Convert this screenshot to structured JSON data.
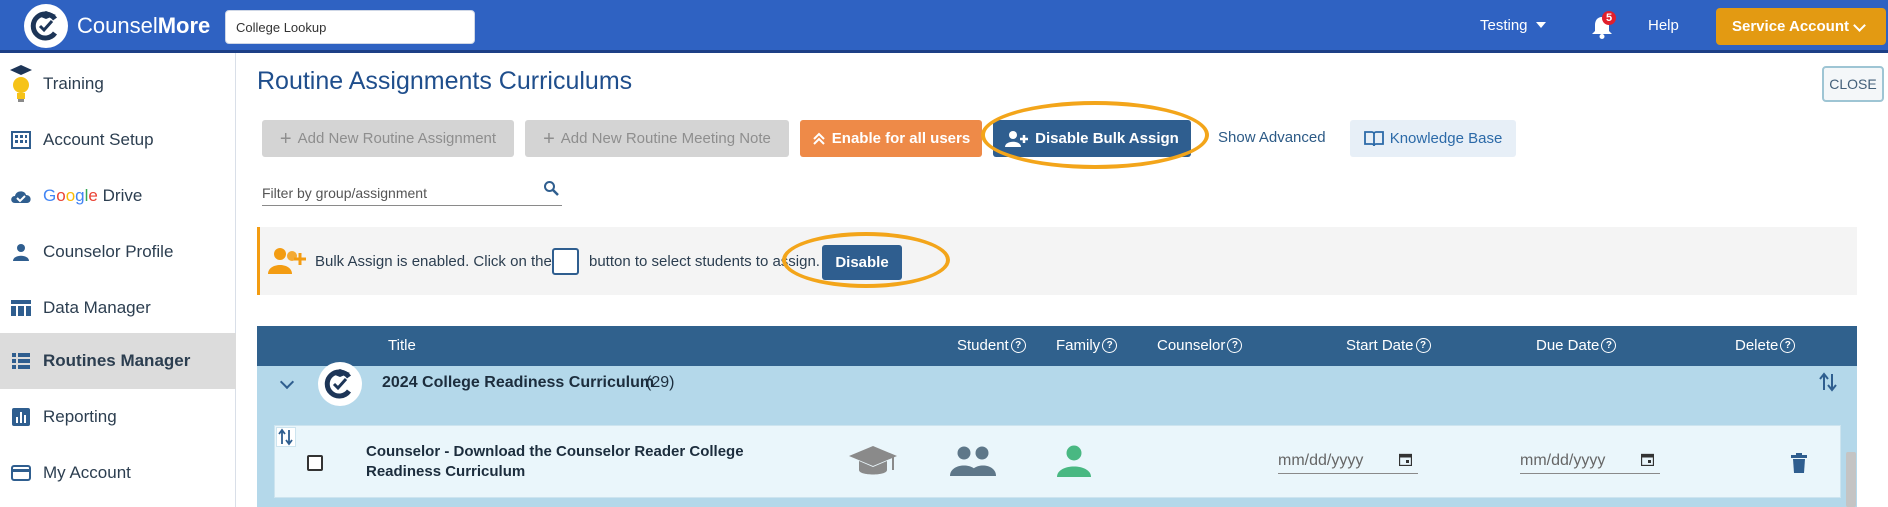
{
  "header": {
    "brand_light": "Counsel",
    "brand_bold": "More",
    "lookup_value": "College Lookup",
    "user_menu": "Testing",
    "notification_count": "5",
    "help": "Help",
    "service_account": "Service Account",
    "bar_color": "#2f62c2",
    "service_color": "#e39a12"
  },
  "sidebar": {
    "items": [
      {
        "label": "Training",
        "icon": "graduation-bulb-icon"
      },
      {
        "label": "Account Setup",
        "icon": "building-icon"
      },
      {
        "label_g": "Google",
        "label": "Drive",
        "icon": "cloud-check-icon"
      },
      {
        "label": "Counselor Profile",
        "icon": "person-icon"
      },
      {
        "label": "Data Manager",
        "icon": "table-icon"
      },
      {
        "label": "Routines Manager",
        "icon": "list-icon",
        "active": true
      },
      {
        "label": "Reporting",
        "icon": "bar-chart-icon"
      },
      {
        "label": "My Account",
        "icon": "card-icon"
      }
    ]
  },
  "main": {
    "title": "Routine Assignments Curriculums",
    "close": "CLOSE",
    "toolbar": {
      "add_assignment": "Add New Routine Assignment",
      "add_note": "Add New Routine Meeting Note",
      "enable_all": "Enable for all users",
      "disable_bulk": "Disable Bulk Assign",
      "show_advanced": "Show Advanced",
      "knowledge_base": "Knowledge Base"
    },
    "filter_placeholder": "Filter by group/assignment",
    "banner": {
      "text_before": "Bulk Assign is enabled. Click on the",
      "text_after": "button to select students to assign.",
      "disable": "Disable"
    },
    "table": {
      "columns": [
        "Title",
        "Student",
        "Family",
        "Counselor",
        "Start Date",
        "Due Date",
        "Delete"
      ],
      "group": {
        "title": "2024 College Readiness Curriculum",
        "count": "(29)"
      },
      "rows": [
        {
          "title": "Counselor - Download the Counselor Reader College Readiness Curriculum",
          "start_placeholder": "mm/dd/yyyy",
          "due_placeholder": "mm/dd/yyyy"
        }
      ]
    }
  }
}
